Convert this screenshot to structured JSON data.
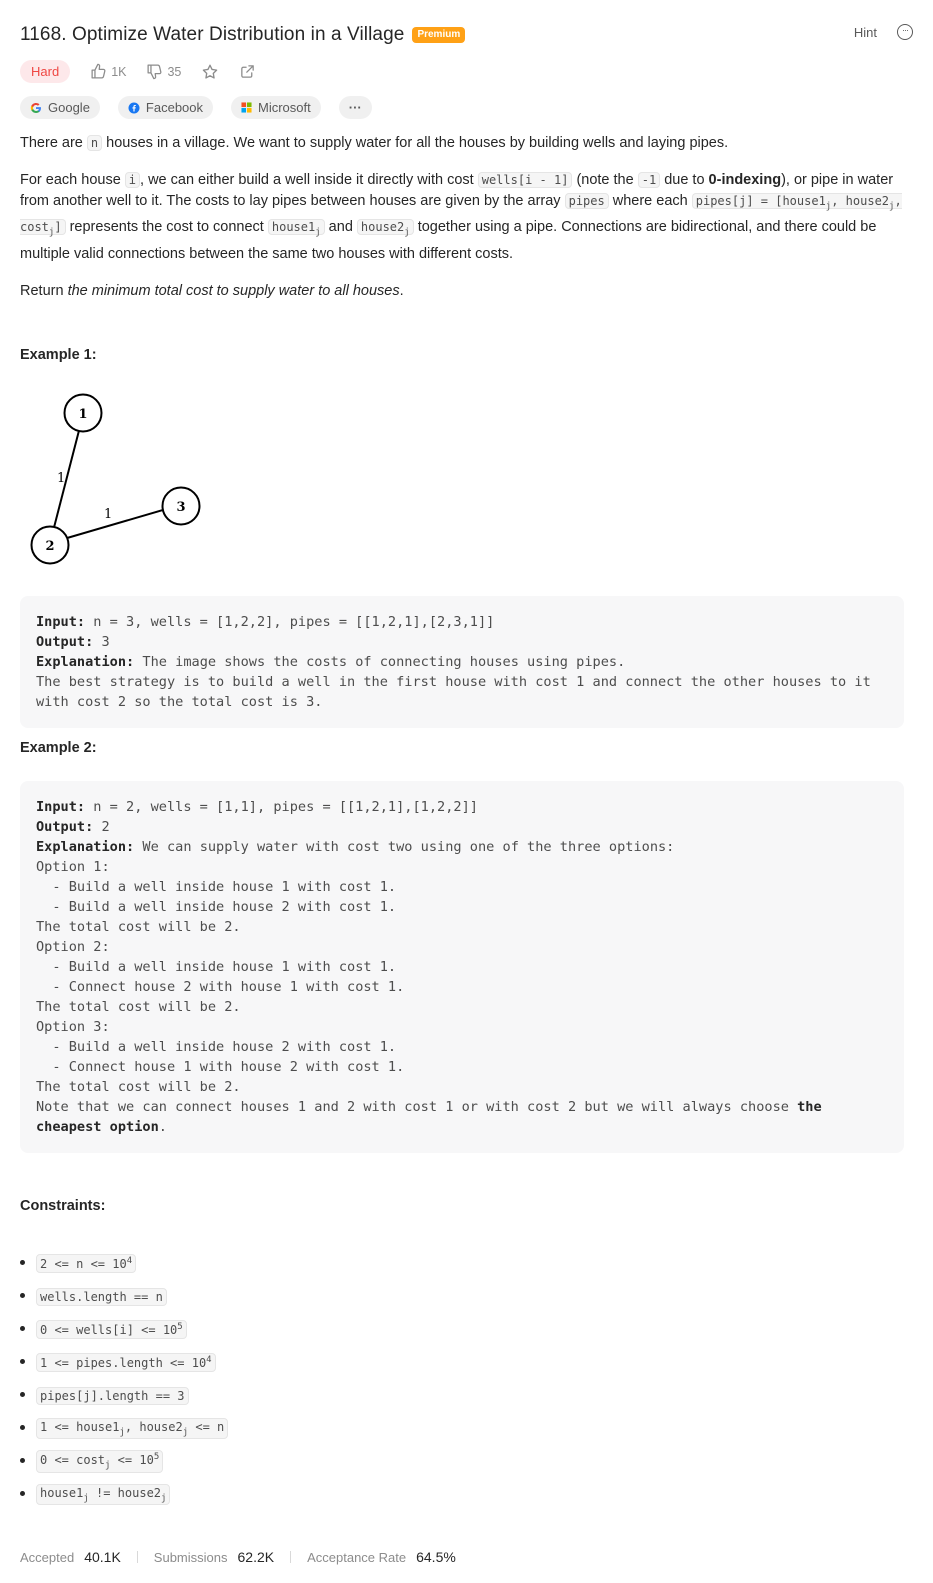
{
  "header": {
    "title": "1168. Optimize Water Distribution in a Village",
    "premium": "Premium",
    "hint": "Hint"
  },
  "meta": {
    "difficulty": "Hard",
    "likes": "1K",
    "dislikes": "35"
  },
  "companies": [
    "Google",
    "Facebook",
    "Microsoft"
  ],
  "companies_more": "···",
  "description": {
    "p1a": "There are ",
    "p1_n": "n",
    "p1b": " houses in a village. We want to supply water for all the houses by building wells and laying pipes.",
    "p2a": "For each house ",
    "p2_i": "i",
    "p2b": ", we can either build a well inside it directly with cost ",
    "p2_wells": "wells[i - 1]",
    "p2c": " (note the ",
    "p2_minus1": "-1",
    "p2d": " due to ",
    "p2_bold": "0-indexing",
    "p2e": "), or pipe in water from another well to it. The costs to lay pipes between houses are given by the array ",
    "p2_pipes": "pipes",
    "p2f": " where each ",
    "p2_pipesj_a": "pipes[j] = [house1",
    "p2_sub_j": "j",
    "p2_pipesj_b": ", house2",
    "p2_pipesj_c": ", cost",
    "p2_pipesj_d": "]",
    "p2g": " represents the cost to connect ",
    "p2_house1": "house1",
    "p2h": " and ",
    "p2_house2": "house2",
    "p2i": " together using a pipe. Connections are bidirectional, and there could be multiple valid connections between the same two houses with different costs.",
    "p3a": "Return ",
    "p3_em": "the minimum total cost to supply water to all houses",
    "p3b": "."
  },
  "example1": {
    "title": "Example 1:",
    "graph": {
      "nodes": [
        "1",
        "2",
        "3"
      ],
      "edges": [
        {
          "from": "1",
          "to": "2",
          "label": "1"
        },
        {
          "from": "2",
          "to": "3",
          "label": "1"
        }
      ]
    },
    "input_label": "Input:",
    "input": " n = 3, wells = [1,2,2], pipes = [[1,2,1],[2,3,1]]",
    "output_label": "Output:",
    "output": " 3",
    "explanation_label": "Explanation:",
    "explanation": " The image shows the costs of connecting houses using pipes.\nThe best strategy is to build a well in the first house with cost 1 and connect the other houses to it with cost 2 so the total cost is 3."
  },
  "example2": {
    "title": "Example 2:",
    "input_label": "Input:",
    "input": " n = 2, wells = [1,1], pipes = [[1,2,1],[1,2,2]]",
    "output_label": "Output:",
    "output": " 2",
    "explanation_label": "Explanation:",
    "explanation": " We can supply water with cost two using one of the three options:\nOption 1:\n  - Build a well inside house 1 with cost 1.\n  - Build a well inside house 2 with cost 1.\nThe total cost will be 2.\nOption 2:\n  - Build a well inside house 1 with cost 1.\n  - Connect house 2 with house 1 with cost 1.\nThe total cost will be 2.\nOption 3:\n  - Build a well inside house 2 with cost 1.\n  - Connect house 1 with house 2 with cost 1.\nThe total cost will be 2.\nNote that we can connect houses 1 and 2 with cost 1 or with cost 2 but we will always choose ",
    "explanation_bold": "the cheapest option",
    "explanation_end": "."
  },
  "constraints": {
    "title": "Constraints:",
    "c1a": "2 <= n <= 10",
    "c1sup": "4",
    "c2": "wells.length == n",
    "c3a": "0 <= wells[i] <= 10",
    "c3sup": "5",
    "c4a": "1 <= pipes.length <= 10",
    "c4sup": "4",
    "c5": "pipes[j].length == 3",
    "c6a": "1 <= house1",
    "c6sub": "j",
    "c6b": ", house2",
    "c6c": " <= n",
    "c7a": "0 <= cost",
    "c7sub": "j",
    "c7b": " <= 10",
    "c7sup": "5",
    "c8a": "house1",
    "c8sub": "j",
    "c8b": " != house2"
  },
  "stats": {
    "accepted_label": "Accepted",
    "accepted": "40.1K",
    "submissions_label": "Submissions",
    "submissions": "62.2K",
    "rate_label": "Acceptance Rate",
    "rate": "64.5%"
  },
  "colors": {
    "hard": "#ef4743",
    "hard_bg": "#fde8ea",
    "premium": "#ffa116",
    "google_blue": "#4285f4",
    "facebook": "#1877f2"
  }
}
